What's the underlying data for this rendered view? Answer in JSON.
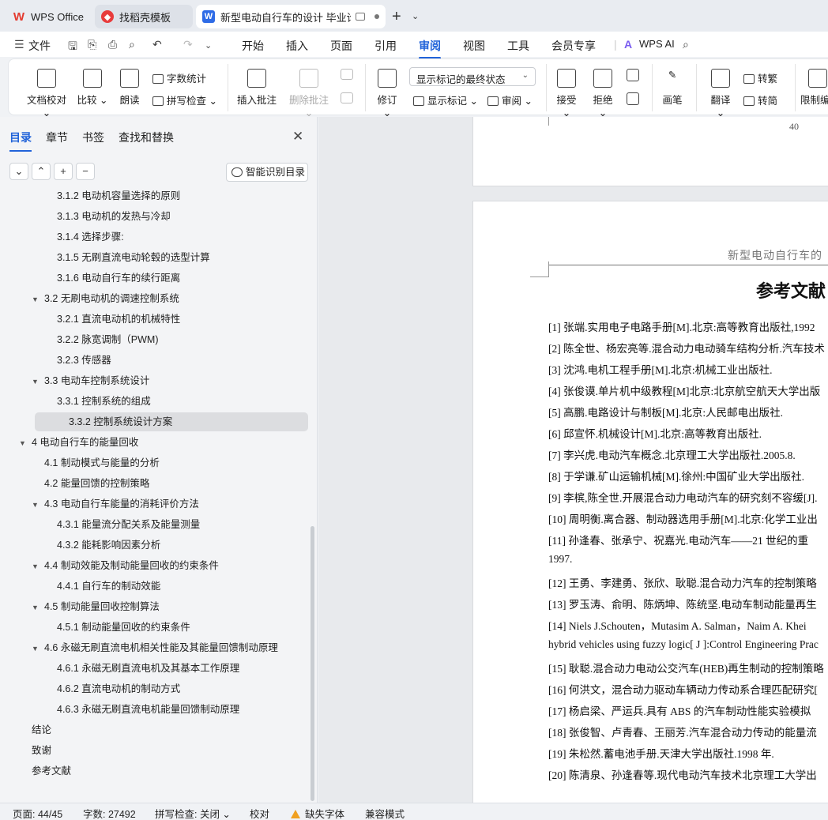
{
  "tabs": {
    "wps_office": "WPS Office",
    "templates": "找稻壳模板",
    "document": "新型电动自行车的设计 毕业论",
    "new_tab": "+"
  },
  "menu": {
    "file": "文件",
    "items": [
      "开始",
      "插入",
      "页面",
      "引用",
      "审阅",
      "视图",
      "工具",
      "会员专享"
    ],
    "active": "审阅",
    "wps_ai": "WPS AI"
  },
  "ribbon": {
    "doc_check": "文档校对",
    "compare": "比较",
    "read_aloud": "朗读",
    "word_count": "字数统计",
    "spell_check": "拼写检查",
    "insert_comment": "插入批注",
    "delete_comment": "删除批注",
    "track_changes": "修订",
    "markup_select": "显示标记的最终状态",
    "show_markup": "显示标记",
    "review": "审阅",
    "accept": "接受",
    "reject": "拒绝",
    "pen": "画笔",
    "translate": "翻译",
    "to_traditional": "转繁",
    "to_simplified": "转简",
    "restrict_edit": "限制编"
  },
  "nav": {
    "tabs": [
      "目录",
      "章节",
      "书签",
      "查找和替换"
    ],
    "smart_toc": "智能识别目录",
    "toc": [
      {
        "label": "3.1.2  电动机容量选择的原则",
        "level": 3
      },
      {
        "label": "3.1.3  电动机的发热与冷却",
        "level": 3
      },
      {
        "label": "3.1.4  选择步骤:",
        "level": 3
      },
      {
        "label": "3.1.5  无刷直流电动轮毂的选型计算",
        "level": 3
      },
      {
        "label": "3.1.6  电动自行车的续行距离",
        "level": 3
      },
      {
        "label": "3.2  无刷电动机的调速控制系统",
        "level": 2,
        "caret": true
      },
      {
        "label": "3.2.1  直流电动机的机械特性",
        "level": 3
      },
      {
        "label": "3.2.2  脉宽调制（PWM)",
        "level": 3
      },
      {
        "label": "3.2.3  传感器",
        "level": 3
      },
      {
        "label": "3.3  电动车控制系统设计",
        "level": 2,
        "caret": true
      },
      {
        "label": "3.3.1  控制系统的组成",
        "level": 3
      },
      {
        "label": "3.3.2  控制系统设计方案",
        "level": 3,
        "selected": true
      },
      {
        "label": "4  电动自行车的能量回收",
        "level": 1,
        "caret": true
      },
      {
        "label": "4.1  制动模式与能量的分析",
        "level": 2
      },
      {
        "label": "4.2  能量回馈的控制策略",
        "level": 2
      },
      {
        "label": "4.3  电动自行车能量的消耗评价方法",
        "level": 2,
        "caret": true
      },
      {
        "label": "4.3.1  能量流分配关系及能量测量",
        "level": 3
      },
      {
        "label": "4.3.2  能耗影响因素分析",
        "level": 3
      },
      {
        "label": "4.4  制动效能及制动能量回收的约束条件",
        "level": 2,
        "caret": true
      },
      {
        "label": "4.4.1  自行车的制动效能",
        "level": 3
      },
      {
        "label": "4.5  制动能量回收控制算法",
        "level": 2,
        "caret": true
      },
      {
        "label": "4.5.1  制动能量回收的约束条件",
        "level": 3
      },
      {
        "label": "4.6  永磁无刷直流电机相关性能及其能量回馈制动原理",
        "level": 2,
        "caret": true
      },
      {
        "label": "4.6.1  永磁无刷直流电机及其基本工作原理",
        "level": 3
      },
      {
        "label": "4.6.2  直流电动机的制动方式",
        "level": 3
      },
      {
        "label": "4.6.3  永磁无刷直流电机能量回馈制动原理",
        "level": 3
      },
      {
        "label": "结论",
        "level": 1
      },
      {
        "label": "致谢",
        "level": 1
      },
      {
        "label": "参考文献",
        "level": 1
      }
    ]
  },
  "document": {
    "prev_page_number": "40",
    "running_head": "新型电动自行车的",
    "section_title": "参考文献",
    "references": [
      "[1] 张端.实用电子电路手册[M].北京:高等教育出版社,1992",
      "[2] 陈全世、杨宏亮等.混合动力电动骑车结构分析.汽车技术",
      "[3] 沈鸿.电机工程手册[M].北京:机械工业出版社.",
      "[4] 张俊谟.单片机中级教程[M]北京:北京航空航天大学出版",
      "[5] 高鹏.电路设计与制板[M].北京:人民邮电出版社.",
      "[6] 邱宣怀.机械设计[M].北京:高等教育出版社.",
      "[7] 李兴虎.电动汽车概念.北京理工大学出版社.2005.8.",
      "[8] 于学谦.矿山运输机械[M].徐州:中国矿业大学出版社.",
      "[9] 李槟,陈全世.开展混合动力电动汽车的研究刻不容缓[J].",
      "[10] 周明衡.离合器、制动器选用手册[M].北京:化学工业出",
      "[11] 孙逢春、张承宁、祝嘉光.电动汽车——21 世纪的重",
      "1997.",
      "[12] 王勇、李建勇、张欣、耿聪.混合动力汽车的控制策略",
      "[13] 罗玉涛、俞明、陈炳坤、陈统坚.电动车制动能量再生",
      "[14]   Niels J.Schouten，Mutasim A. Salman，Naim A. Khei",
      "hybrid vehicles using fuzzy logic[ J ]:Control Engineering Prac",
      "[15] 耿聪.混合动力电动公交汽车(HEB)再生制动的控制策略",
      "[16] 何洪文，混合动力驱动车辆动力传动系合理匹配研究[",
      "[17] 杨启梁、严运兵.具有  ABS  的汽车制动性能实验模拟",
      "[18] 张俊智、卢青春、王丽芳.汽车混合动力传动的能量流",
      "[19] 朱松然.蓄电池手册.天津大学出版社.1998 年.",
      "[20] 陈清泉、孙逢春等.现代电动汽车技术北京理工大学出"
    ]
  },
  "status": {
    "page": "页面: 44/45",
    "words": "字数: 27492",
    "spell": "拼写检查: 关闭",
    "proofread": "校对",
    "missing_fonts": "缺失字体",
    "compat": "兼容模式"
  },
  "colors": {
    "accent": "#2163d9",
    "selected_row": "#dcdde0"
  }
}
